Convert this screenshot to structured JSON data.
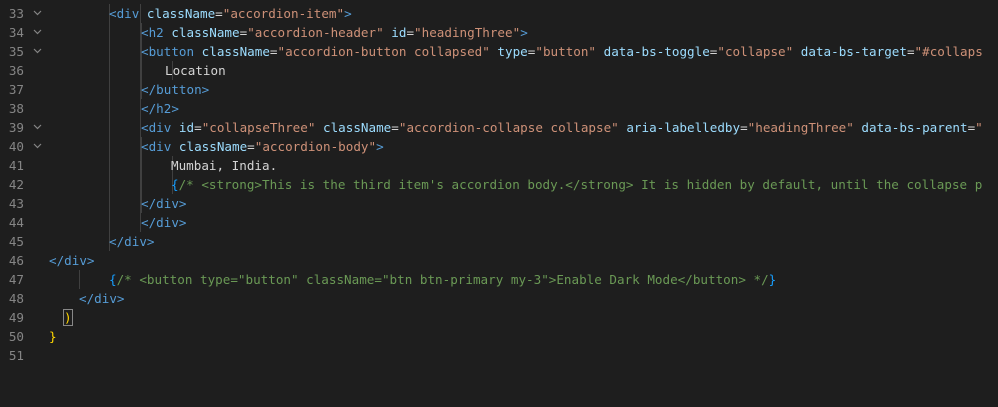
{
  "editor": {
    "lines": [
      {
        "number": "33",
        "fold": true,
        "indent": 60,
        "guides": [
          60,
          91
        ],
        "segments": [
          {
            "t": "<div ",
            "c": "tag"
          },
          {
            "t": "className",
            "c": "attr"
          },
          {
            "t": "=",
            "c": "txt"
          },
          {
            "t": "\"accordion-item\"",
            "c": "str"
          },
          {
            "t": ">",
            "c": "tag"
          }
        ]
      },
      {
        "number": "34",
        "fold": true,
        "indent": 92,
        "guides": [
          60,
          91,
          92
        ],
        "segments": [
          {
            "t": "<h2 ",
            "c": "tag"
          },
          {
            "t": "className",
            "c": "attr"
          },
          {
            "t": "=",
            "c": "txt"
          },
          {
            "t": "\"accordion-header\"",
            "c": "str"
          },
          {
            "t": " ",
            "c": "txt"
          },
          {
            "t": "id",
            "c": "attr"
          },
          {
            "t": "=",
            "c": "txt"
          },
          {
            "t": "\"headingThree\"",
            "c": "str"
          },
          {
            "t": ">",
            "c": "tag"
          }
        ]
      },
      {
        "number": "35",
        "fold": true,
        "indent": 92,
        "guides": [
          60,
          91,
          92
        ],
        "segments": [
          {
            "t": "<button ",
            "c": "tag"
          },
          {
            "t": "className",
            "c": "attr"
          },
          {
            "t": "=",
            "c": "txt"
          },
          {
            "t": "\"accordion-button collapsed\"",
            "c": "str"
          },
          {
            "t": " ",
            "c": "txt"
          },
          {
            "t": "type",
            "c": "attr"
          },
          {
            "t": "=",
            "c": "txt"
          },
          {
            "t": "\"button\"",
            "c": "str"
          },
          {
            "t": " ",
            "c": "txt"
          },
          {
            "t": "data-bs-toggle",
            "c": "attr"
          },
          {
            "t": "=",
            "c": "txt"
          },
          {
            "t": "\"collapse\"",
            "c": "str"
          },
          {
            "t": " ",
            "c": "txt"
          },
          {
            "t": "data-bs-target",
            "c": "attr"
          },
          {
            "t": "=",
            "c": "txt"
          },
          {
            "t": "\"#collaps",
            "c": "str"
          }
        ]
      },
      {
        "number": "36",
        "fold": false,
        "indent": 116,
        "guides": [
          60,
          91,
          92,
          123
        ],
        "segments": [
          {
            "t": "Location",
            "c": "txt"
          }
        ]
      },
      {
        "number": "37",
        "fold": false,
        "indent": 92,
        "guides": [
          60,
          91,
          92
        ],
        "segments": [
          {
            "t": "</button>",
            "c": "tag"
          }
        ]
      },
      {
        "number": "38",
        "fold": false,
        "indent": 92,
        "guides": [
          60,
          91
        ],
        "segments": [
          {
            "t": "</h2>",
            "c": "tag"
          }
        ]
      },
      {
        "number": "39",
        "fold": true,
        "indent": 92,
        "guides": [
          60,
          91
        ],
        "segments": [
          {
            "t": "<div ",
            "c": "tag"
          },
          {
            "t": "id",
            "c": "attr"
          },
          {
            "t": "=",
            "c": "txt"
          },
          {
            "t": "\"collapseThree\"",
            "c": "str"
          },
          {
            "t": " ",
            "c": "txt"
          },
          {
            "t": "className",
            "c": "attr"
          },
          {
            "t": "=",
            "c": "txt"
          },
          {
            "t": "\"accordion-collapse collapse\"",
            "c": "str"
          },
          {
            "t": " ",
            "c": "txt"
          },
          {
            "t": "aria-labelledby",
            "c": "attr"
          },
          {
            "t": "=",
            "c": "txt"
          },
          {
            "t": "\"headingThree\"",
            "c": "str"
          },
          {
            "t": " ",
            "c": "txt"
          },
          {
            "t": "data-bs-parent",
            "c": "attr"
          },
          {
            "t": "=",
            "c": "txt"
          },
          {
            "t": "\"",
            "c": "str"
          }
        ]
      },
      {
        "number": "40",
        "fold": true,
        "indent": 92,
        "guides": [
          60,
          91,
          92
        ],
        "segments": [
          {
            "t": "<div ",
            "c": "tag"
          },
          {
            "t": "className",
            "c": "attr"
          },
          {
            "t": "=",
            "c": "txt"
          },
          {
            "t": "\"accordion-body\"",
            "c": "str"
          },
          {
            "t": ">",
            "c": "tag"
          }
        ]
      },
      {
        "number": "41",
        "fold": false,
        "indent": 122,
        "guides": [
          60,
          91,
          92,
          123
        ],
        "segments": [
          {
            "t": "Mumbai, India.",
            "c": "txt"
          }
        ]
      },
      {
        "number": "42",
        "fold": false,
        "indent": 122,
        "guides": [
          60,
          91,
          92,
          123
        ],
        "segments": [
          {
            "t": "{",
            "c": "jsx"
          },
          {
            "t": "/* <strong>This is the third item's accordion body.</strong> It is hidden by default, until the collapse p",
            "c": "cmt"
          }
        ]
      },
      {
        "number": "43",
        "fold": false,
        "indent": 92,
        "guides": [
          60,
          91,
          92
        ],
        "segments": [
          {
            "t": "</div>",
            "c": "tag"
          }
        ]
      },
      {
        "number": "44",
        "fold": false,
        "indent": 92,
        "guides": [
          60,
          91
        ],
        "segments": [
          {
            "t": "</div>",
            "c": "tag"
          }
        ]
      },
      {
        "number": "45",
        "fold": false,
        "indent": 60,
        "guides": [
          60
        ],
        "segments": [
          {
            "t": "</div>",
            "c": "tag"
          }
        ]
      },
      {
        "number": "46",
        "fold": false,
        "indent": 0,
        "guides": [],
        "segments": [
          {
            "t": "</div>",
            "c": "tag"
          }
        ]
      },
      {
        "number": "47",
        "fold": false,
        "indent": 60,
        "guides": [
          30
        ],
        "segments": [
          {
            "t": "{",
            "c": "jsx"
          },
          {
            "t": "/* <button type=\"button\" className=\"btn btn-primary my-3\">Enable Dark Mode</button> */",
            "c": "cmt"
          },
          {
            "t": "}",
            "c": "jsx"
          }
        ]
      },
      {
        "number": "48",
        "fold": false,
        "indent": 30,
        "guides": [],
        "segments": [
          {
            "t": "</div>",
            "c": "tag"
          }
        ]
      },
      {
        "number": "49",
        "fold": false,
        "indent": 15,
        "guides": [],
        "segments": [
          {
            "t": ")",
            "c": "brc",
            "box": true
          }
        ]
      },
      {
        "number": "50",
        "fold": false,
        "indent": 0,
        "guides": [],
        "segments": [
          {
            "t": "}",
            "c": "brc"
          }
        ]
      },
      {
        "number": "51",
        "fold": false,
        "indent": 0,
        "guides": [],
        "segments": []
      }
    ]
  },
  "colors": {
    "background": "#1e1e1e",
    "line_number": "#858585",
    "tag": "#569cd6",
    "attribute": "#9cdcfe",
    "string": "#ce9178",
    "comment": "#6a9955",
    "bracket": "#ffd700"
  },
  "icons": {
    "fold": "chevron-down-icon"
  }
}
